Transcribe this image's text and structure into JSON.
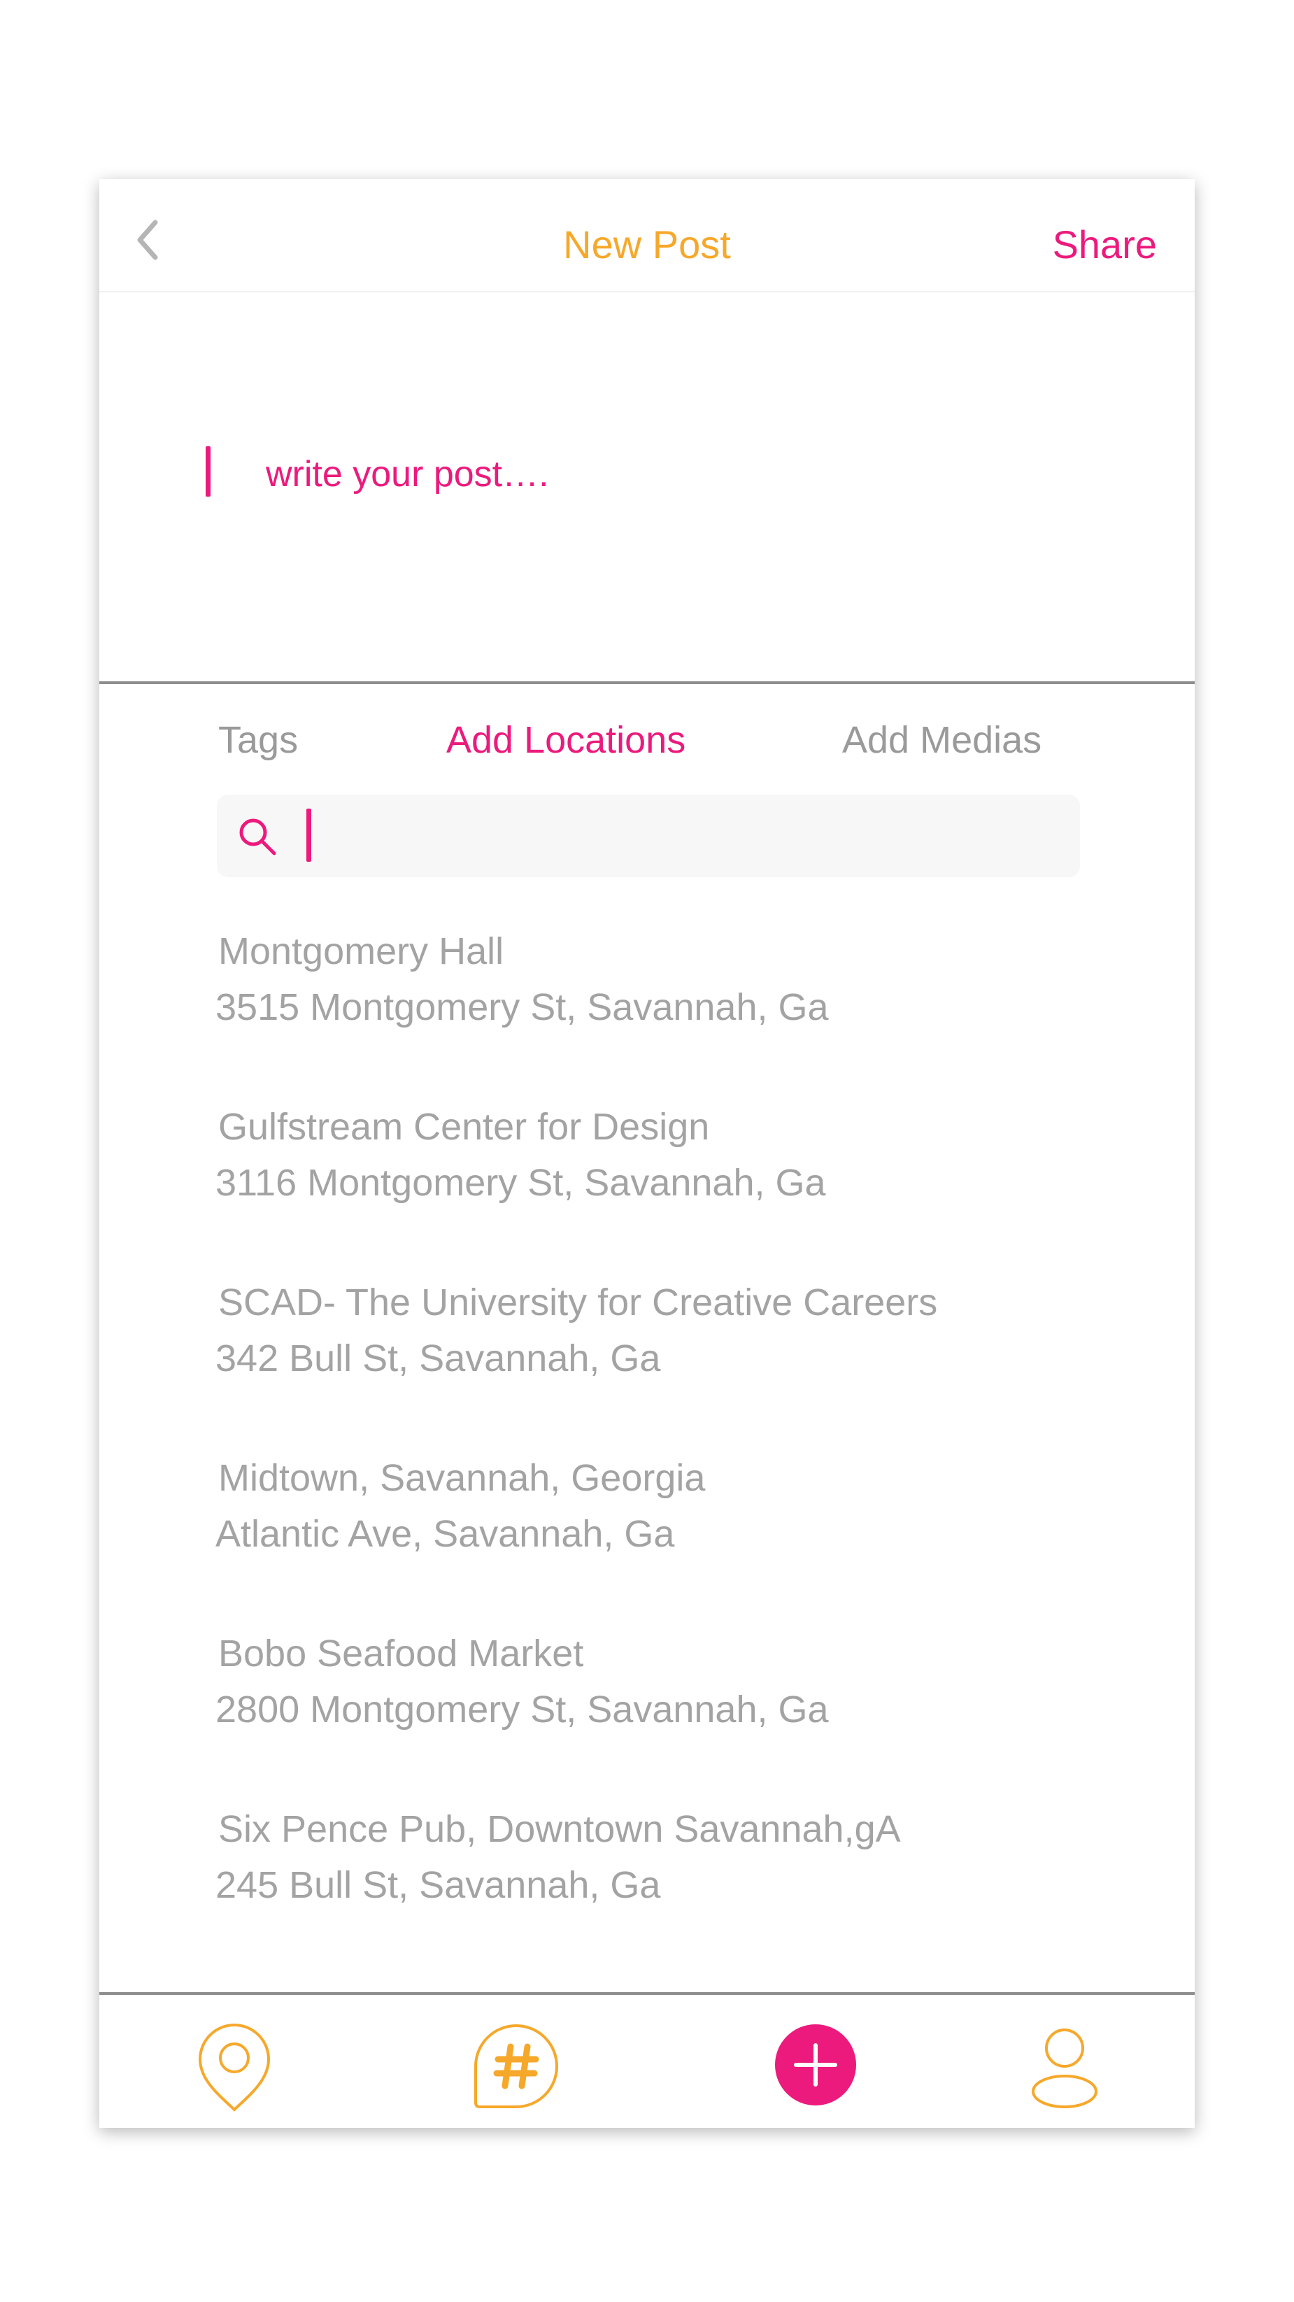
{
  "colors": {
    "accent_pink": "#ec1a7d",
    "accent_orange": "#f6a82b",
    "text_gray": "#a3a3a3",
    "divider": "#8e8e8e"
  },
  "header": {
    "back_icon": "chevron-left-icon",
    "title": "New Post",
    "share_label": "Share"
  },
  "compose": {
    "placeholder": "write your post…."
  },
  "tabs": [
    {
      "label": "Tags",
      "active": false
    },
    {
      "label": "Add Locations",
      "active": true
    },
    {
      "label": "Add Medias",
      "active": false
    }
  ],
  "search": {
    "icon": "search-icon",
    "value": "",
    "placeholder": ""
  },
  "locations": [
    {
      "name": "Montgomery Hall",
      "address": "3515 Montgomery St, Savannah, Ga"
    },
    {
      "name": "Gulfstream Center for Design",
      "address": "3116 Montgomery St, Savannah, Ga"
    },
    {
      "name": "SCAD- The University for Creative Careers",
      "address": "342 Bull St, Savannah, Ga"
    },
    {
      "name": "Midtown, Savannah, Georgia",
      "address": "Atlantic Ave, Savannah, Ga"
    },
    {
      "name": "Bobo Seafood Market",
      "address": "2800 Montgomery St, Savannah, Ga"
    },
    {
      "name": "Six Pence Pub, Downtown Savannah,gA",
      "address": "245 Bull St, Savannah, Ga"
    }
  ],
  "bottom_nav": {
    "items": [
      {
        "icon": "location-pin-icon"
      },
      {
        "icon": "hashtag-icon"
      },
      {
        "icon": "plus-icon"
      },
      {
        "icon": "profile-icon"
      }
    ]
  }
}
